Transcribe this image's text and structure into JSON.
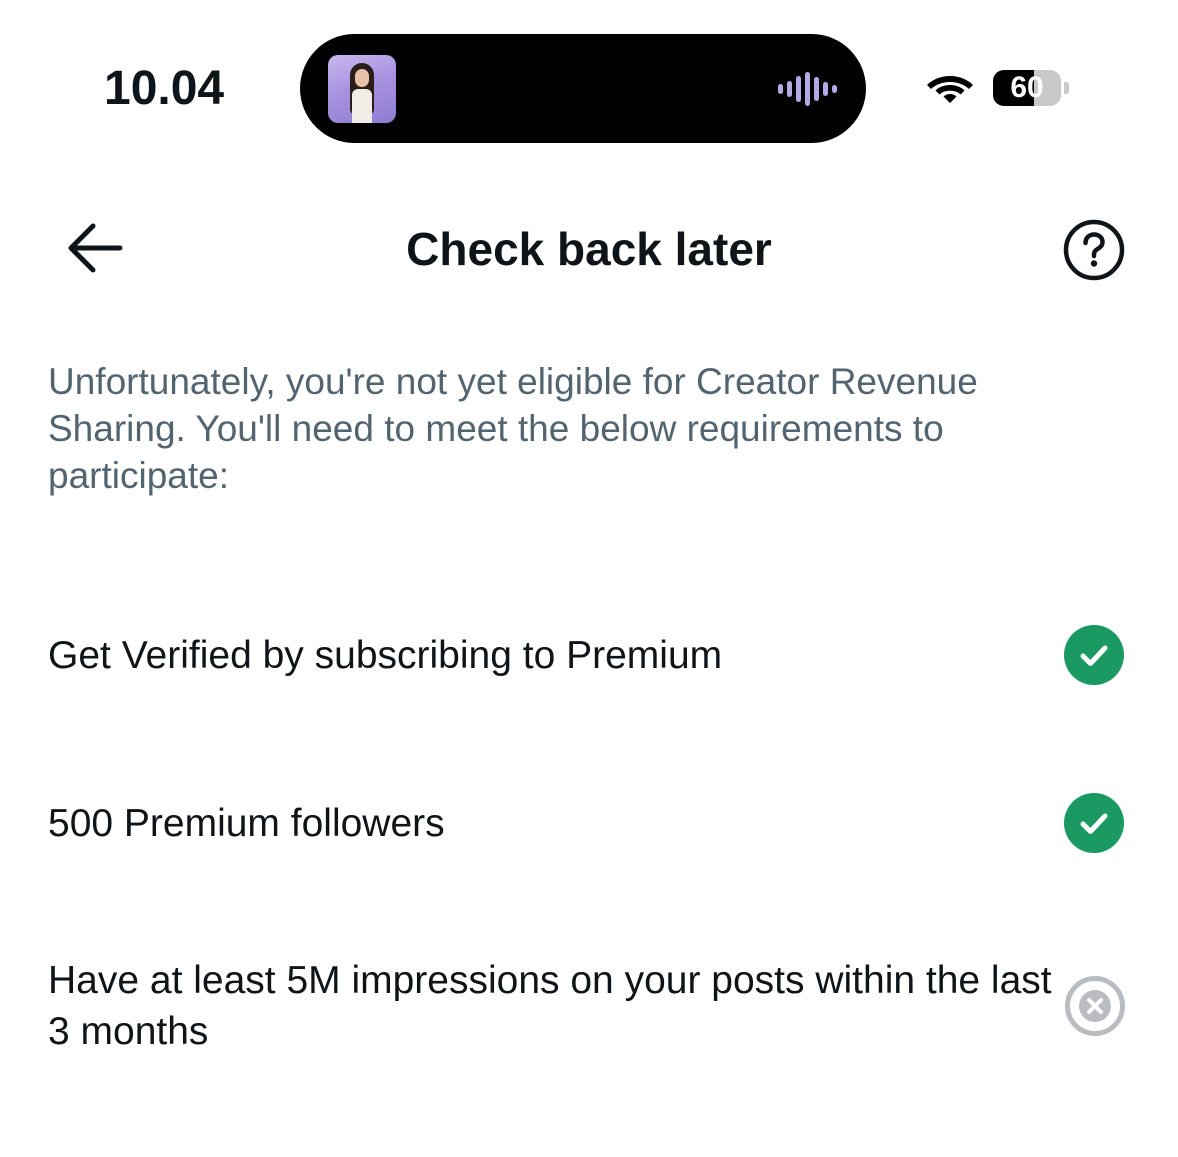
{
  "status_bar": {
    "time": "10.04",
    "battery_level": "60",
    "battery_fraction": 0.6,
    "icons": [
      "now-playing-avatar",
      "audio-waveform-icon",
      "wifi-icon",
      "battery-icon"
    ]
  },
  "header": {
    "title": "Check back later",
    "back_icon": "arrow-left-icon",
    "help_icon": "question-circle-icon"
  },
  "description": "Unfortunately, you're not yet eligible for Creator Revenue Sharing. You'll need to meet the below requirements to participate:",
  "requirements": [
    {
      "label": "Get Verified by subscribing to Premium",
      "met": true,
      "icon": "check-circle-icon"
    },
    {
      "label": "500 Premium followers",
      "met": true,
      "icon": "check-circle-icon"
    },
    {
      "label": "Have at least 5M impressions on your posts within the last 3 months",
      "met": false,
      "icon": "x-circle-icon"
    }
  ],
  "colors": {
    "met": "#1a9a62",
    "unmet": "#b9bdc1",
    "description_text": "#536471",
    "primary_text": "#0f1419"
  }
}
